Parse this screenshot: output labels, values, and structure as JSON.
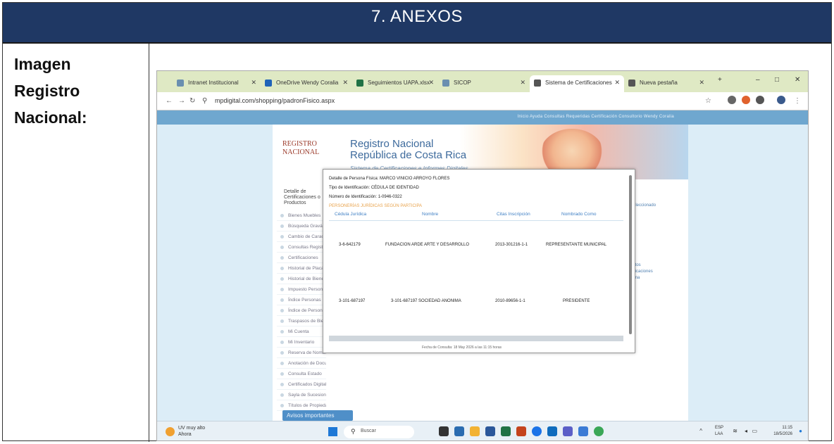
{
  "section": {
    "title": "7.   ANEXOS"
  },
  "label": {
    "text": "Imagen\nRegistro\nNacional:"
  },
  "browser": {
    "tabs": [
      {
        "label": "Intranet Institucional",
        "color": "#6a8fb0"
      },
      {
        "label": "OneDrive Wendy Coralia",
        "color": "#1f63b8"
      },
      {
        "label": "Seguimientos UAPA.xlsx",
        "color": "#207245"
      },
      {
        "label": "SICOP",
        "color": "#6a8fb0"
      },
      {
        "label": "Sistema de Certificaciones",
        "color": "#555555"
      },
      {
        "label": "Nueva pestaña",
        "color": "#555555"
      }
    ],
    "url": "mpdigital.com/shopping/padronFisico.aspx",
    "win_min": "–",
    "win_max": "□",
    "win_close": "✕",
    "new_tab": "+"
  },
  "site": {
    "menu": "Inicio   Ayuda   Consultas Requeridas   Certificación   Consultorio   Wendy Coralia",
    "logo": "REGISTRO\nNACIONAL",
    "title_line1": "Registro Nacional",
    "title_line2": "República de Costa Rica",
    "subtitle": "Sistema de Certificaciones e Informes Digitales",
    "left_menu_head": "Detalle de Certificaciones o Productos",
    "left_menu": [
      "Bienes Muebles",
      "Búsqueda Gravámenes",
      "Cambio de Características",
      "Consultas Registrales",
      "Certificaciones",
      "Historial de Placas",
      "Historial de Bienes",
      "Impuesto Personas",
      "Índice Personas",
      "Índice de Personas",
      "Traspasos de Bienes",
      "Mi Cuenta",
      "Mi Inventario",
      "Reserva de Nombres",
      "Anotación de Documentos",
      "Consulta Estado",
      "Certificados Digitales",
      "Sayla de Sucesiones",
      "Títulos de Propiedad"
    ],
    "avisos": "Avisos importantes",
    "right_note_1": "Seleccionado",
    "right_note_2": "datos\nubicaciones\ntema"
  },
  "modal": {
    "line1": "Detalle de Persona Física: MARCO VINICIO ARROYO FLORES",
    "line2": "Tipo de Identificación: CÉDULA DE IDENTIDAD",
    "line3": "Número de Identificación: 1-0946-0322",
    "section": "PERSONERÍAS JURÍDICAS SEGÚN PARTICIPA",
    "columns": [
      "Cédula Jurídica",
      "Nombre",
      "Citas Inscripción",
      "Nombrado Como"
    ],
    "rows": [
      [
        "3-6-642179",
        "FUNDACION ARDE ARTE Y DESARROLLO",
        "2013-301216-1-1",
        "REPRESENTANTE MUNICIPAL"
      ],
      [
        "3-101-687197",
        "3-101-687197 SOCIEDAD ANONIMA",
        "2010-89656-1-1",
        "PRESIDENTE"
      ]
    ],
    "footer": "Fecha de Consulta: 18 May 2026 a las 11:15 horas"
  },
  "taskbar": {
    "weather_line1": "UV muy alto",
    "weather_line2": "Ahora",
    "search": "Buscar",
    "lang_line1": "ESP",
    "lang_line2": "LAA",
    "time": "11:15",
    "date": "18/5/2026"
  },
  "colors": {
    "band": "#1f3864",
    "accent": "#3f7fc4",
    "orange": "#e8a24a"
  }
}
